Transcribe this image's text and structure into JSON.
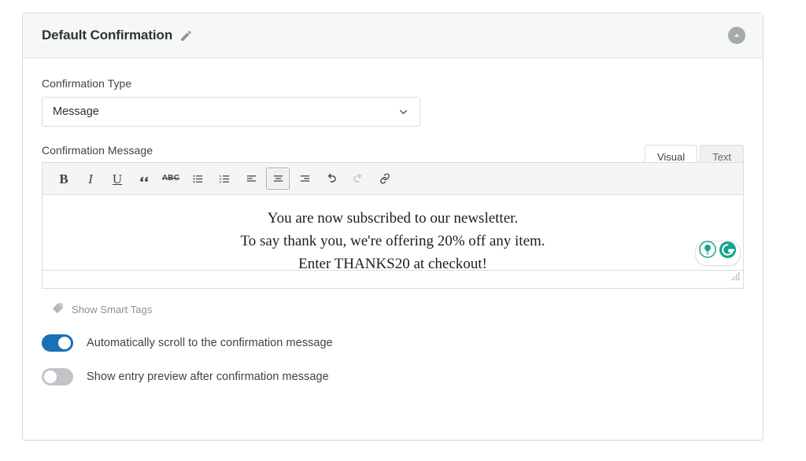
{
  "card": {
    "title": "Default Confirmation",
    "edit_icon": "pencil-icon",
    "collapse_icon": "chevron-up-circle-icon"
  },
  "confirmation_type": {
    "label": "Confirmation Type",
    "value": "Message",
    "chevron_icon": "chevron-down-icon",
    "options": [
      "Message"
    ]
  },
  "confirmation_message": {
    "label": "Confirmation Message",
    "tabs": [
      {
        "label": "Visual",
        "active": true
      },
      {
        "label": "Text",
        "active": false
      }
    ],
    "toolbar": [
      {
        "name": "bold",
        "glyph": "B",
        "active": false,
        "disabled": false
      },
      {
        "name": "italic",
        "glyph": "I",
        "active": false,
        "disabled": false
      },
      {
        "name": "underline",
        "glyph": "U",
        "active": false,
        "disabled": false
      },
      {
        "name": "blockquote",
        "glyph": "“",
        "active": false,
        "disabled": false
      },
      {
        "name": "strikethrough",
        "glyph": "ABC",
        "active": false,
        "disabled": false
      },
      {
        "name": "bulleted-list",
        "glyph": "",
        "active": false,
        "disabled": false
      },
      {
        "name": "numbered-list",
        "glyph": "",
        "active": false,
        "disabled": false
      },
      {
        "name": "align-left",
        "glyph": "",
        "active": false,
        "disabled": false
      },
      {
        "name": "align-center",
        "glyph": "",
        "active": true,
        "disabled": false
      },
      {
        "name": "align-right",
        "glyph": "",
        "active": false,
        "disabled": false
      },
      {
        "name": "undo",
        "glyph": "",
        "active": false,
        "disabled": false
      },
      {
        "name": "redo",
        "glyph": "",
        "active": false,
        "disabled": true
      },
      {
        "name": "insert-link",
        "glyph": "",
        "active": false,
        "disabled": false
      }
    ],
    "content_lines": [
      "You are now subscribed to our newsletter.",
      "To say thank you, we're offering 20% off any item.",
      "Enter THANKS20 at checkout!"
    ],
    "grammarly": {
      "assistant_icon": "lightbulb-icon",
      "logo_icon": "grammarly-g-icon",
      "color": "#15a38a"
    },
    "resize_handle": "resize-grip-icon"
  },
  "smart_tags": {
    "icon": "tag-icon",
    "label": "Show Smart Tags"
  },
  "toggles": [
    {
      "name": "auto-scroll",
      "label": "Automatically scroll to the confirmation message",
      "on": true
    },
    {
      "name": "show-entry-preview",
      "label": "Show entry preview after confirmation message",
      "on": false
    }
  ],
  "colors": {
    "toggle_on": "#1a6fb5",
    "toggle_off": "#c3c4c7",
    "header_bg": "#f6f7f7",
    "border": "#dcdcde",
    "grammarly_teal": "#15a38a"
  }
}
